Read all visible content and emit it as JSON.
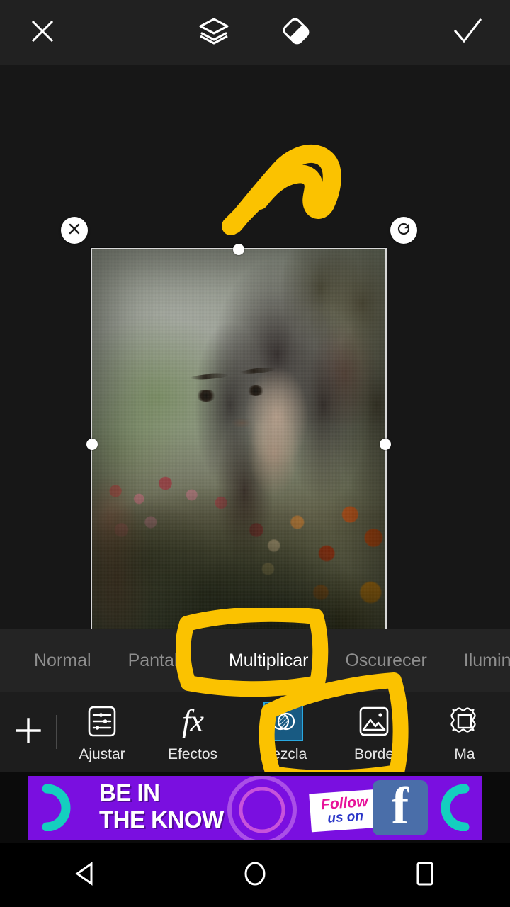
{
  "app": {
    "platform": "android",
    "accent_yellow": "#fbc200",
    "toolbar_bg": "#212121",
    "canvas_bg": "#171717",
    "selected_tile_bg": "#185a82",
    "selected_tile_border": "#29a8e0"
  },
  "topbar": {
    "close": {
      "name": "close-icon",
      "label": "Cerrar"
    },
    "layers": {
      "name": "layers-icon",
      "label": "Capas"
    },
    "eraser": {
      "name": "eraser-icon",
      "label": "Borrador"
    },
    "confirm": {
      "name": "check-icon",
      "label": "Aplicar"
    }
  },
  "canvas": {
    "layer_handles": {
      "close": "close-handle",
      "rotate": "rotate-handle",
      "resize": "resize-handle"
    },
    "photo_alt": "Doble exposición: retrato de mujer mezclado con jardín de flores"
  },
  "annotations": [
    {
      "name": "arrow-annotation",
      "target": "layers-icon",
      "color": "#fbc200"
    },
    {
      "name": "highlight-multiplicar",
      "target": "blend-mode-multiplicar",
      "color": "#fbc200"
    },
    {
      "name": "highlight-mezcla",
      "target": "tool-mezcla",
      "color": "#fbc200"
    }
  ],
  "blend_modes": {
    "selected": "Multiplicar",
    "items": [
      {
        "label": "Normal",
        "active": false
      },
      {
        "label": "Pantalla",
        "active": false
      },
      {
        "label": "Multiplicar",
        "active": true
      },
      {
        "label": "Oscurecer",
        "active": false
      },
      {
        "label": "Iluminar",
        "active": false
      }
    ]
  },
  "tools": {
    "add_label": "+",
    "selected": "Mezcla",
    "items": [
      {
        "label": "Ajustar",
        "icon": "sliders-icon",
        "selected": false
      },
      {
        "label": "Efectos",
        "icon": "fx-icon",
        "selected": false
      },
      {
        "label": "Mezcla",
        "icon": "blend-circles-icon",
        "selected": true
      },
      {
        "label": "Borde",
        "icon": "image-icon",
        "selected": false
      },
      {
        "label": "Ma",
        "icon": "frame-mask-icon",
        "selected": false
      }
    ]
  },
  "ad": {
    "line1": "BE IN",
    "line2": "THE KNOW",
    "follow_line1": "Follow",
    "follow_line2": "us on",
    "fb_glyph": "f",
    "bg_color": "#7a0fe0"
  },
  "navbar": {
    "back": "back-button",
    "home": "home-button",
    "recents": "recents-button"
  }
}
